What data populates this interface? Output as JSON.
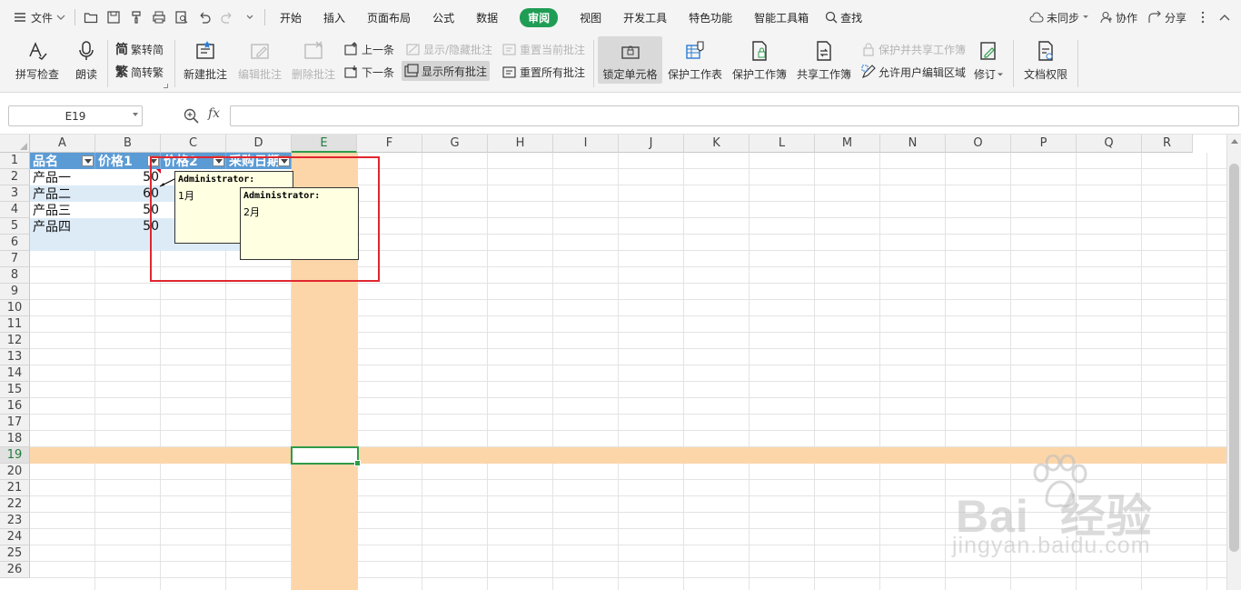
{
  "menubar": {
    "file_label": "文件",
    "tabs": [
      "开始",
      "插入",
      "页面布局",
      "公式",
      "数据",
      "审阅",
      "视图",
      "开发工具",
      "特色功能",
      "智能工具箱"
    ],
    "active_tab": "审阅",
    "search_label": "查找",
    "sync_label": "未同步",
    "collab_label": "协作",
    "share_label": "分享"
  },
  "ribbon": {
    "spell_check": "拼写检查",
    "read_aloud": "朗读",
    "to_traditional": "繁转简",
    "to_simplified": "简转繁",
    "new_comment": "新建批注",
    "edit_comment": "编辑批注",
    "delete_comment": "删除批注",
    "prev_comment": "上一条",
    "next_comment": "下一条",
    "show_hide_comment": "显示/隐藏批注",
    "show_all_comments": "显示所有批注",
    "reset_current_comment": "重置当前批注",
    "reset_all_comments": "重置所有批注",
    "lock_cell": "锁定单元格",
    "protect_sheet": "保护工作表",
    "protect_workbook": "保护工作簿",
    "share_workbook": "共享工作簿",
    "protect_and_share": "保护并共享工作簿",
    "allow_edit_ranges": "允许用户编辑区域",
    "track_changes": "修订",
    "doc_permission": "文档权限"
  },
  "formula_bar": {
    "name_box": "E19",
    "fx_label": "fx",
    "formula": ""
  },
  "grid": {
    "columns": [
      "A",
      "B",
      "C",
      "D",
      "E",
      "F",
      "G",
      "H",
      "I",
      "J",
      "K",
      "L",
      "M",
      "N",
      "O",
      "P",
      "Q",
      "R"
    ],
    "rows": [
      "1",
      "2",
      "3",
      "4",
      "5",
      "6",
      "7",
      "8",
      "9",
      "10",
      "11",
      "12",
      "13",
      "14",
      "15",
      "16",
      "17",
      "18",
      "19",
      "20",
      "21",
      "22",
      "23",
      "24",
      "25",
      "26"
    ],
    "selected_column": "E",
    "selected_row": "19",
    "headers": [
      "品名",
      "价格1",
      "价格2",
      "采购日期"
    ],
    "data": [
      {
        "name": "产品一",
        "price1": "50"
      },
      {
        "name": "产品二",
        "price1": "60"
      },
      {
        "name": "产品三",
        "price1": "50"
      },
      {
        "name": "产品四",
        "price1": "50"
      }
    ]
  },
  "comments": [
    {
      "author": "Administrator:",
      "text": "1月"
    },
    {
      "author": "Administrator:",
      "text": "2月"
    }
  ],
  "watermark": {
    "brand": "Bai",
    "brand_suffix": "经验",
    "url": "jingyan.baidu.com"
  },
  "colors": {
    "accent_green": "#1f9d55",
    "table_header": "#5b9bd5",
    "band_row": "#ddebf7",
    "highlight": "#fcd6a9",
    "comment_bg": "#ffffe1",
    "annotation_red": "#e0262f"
  }
}
